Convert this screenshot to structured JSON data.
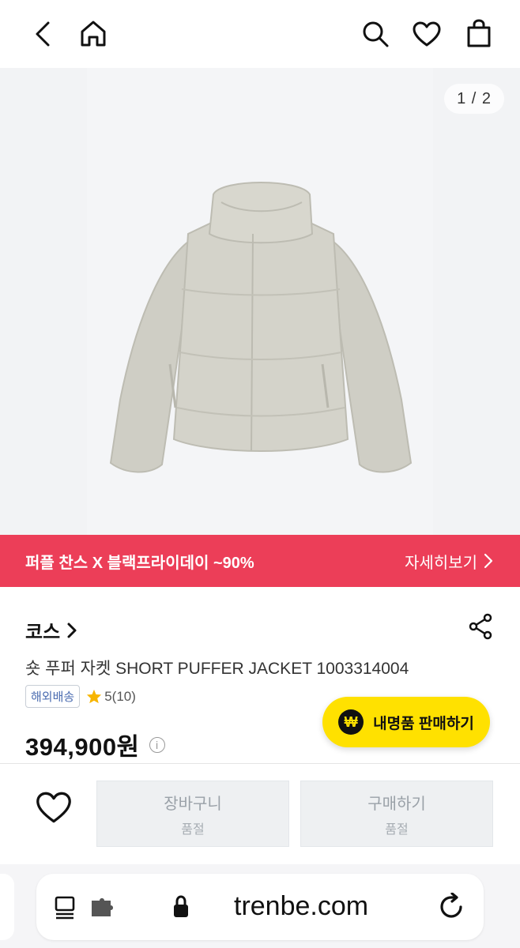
{
  "topbar": {
    "back_icon": "chevron-left-icon",
    "home_icon": "home-icon",
    "search_icon": "search-icon",
    "wishlist_icon": "heart-icon",
    "bag_icon": "shopping-bag-icon"
  },
  "gallery": {
    "counter": "1 / 2",
    "image_subject": "jacket-photo"
  },
  "promo_banner": {
    "title": "퍼플 찬스 X 블랙프라이데이 ~90%",
    "link_label": "자세히보기",
    "color": "#ec3e58"
  },
  "product": {
    "brand": "코스",
    "name": "숏 푸퍼 자켓 SHORT PUFFER JACKET 1003314004",
    "shipping_badge": "해외배송",
    "rating": "5(10)",
    "price": "394,900원"
  },
  "sell_button": {
    "label": "내명품 판매하기",
    "icon_glyph": "₩",
    "color": "#ffe100"
  },
  "actions": {
    "cart_label": "장바구니",
    "cart_status": "품절",
    "buy_label": "구매하기",
    "buy_status": "품절"
  },
  "browser": {
    "url": "trenbe.com"
  }
}
